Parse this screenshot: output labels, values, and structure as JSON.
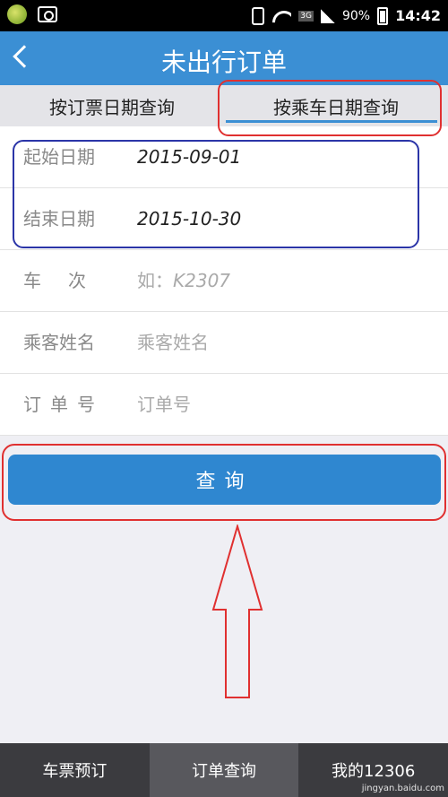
{
  "status_bar": {
    "battery_percent": "90%",
    "time": "14:42",
    "network_type": "3G",
    "icons": [
      "app-icon",
      "camera-icon",
      "phone-icon",
      "wifi-icon",
      "signal-icon",
      "battery-icon"
    ]
  },
  "nav": {
    "title": "未出行订单",
    "back_icon": "chevron-left-icon"
  },
  "tabs": [
    {
      "label": "按订票日期查询",
      "active": false
    },
    {
      "label": "按乘车日期查询",
      "active": true
    }
  ],
  "form": {
    "start_date": {
      "label": "起始日期",
      "value": "2015-09-01"
    },
    "end_date": {
      "label": "结束日期",
      "value": "2015-10-30"
    },
    "train_no": {
      "label_parts": [
        "车",
        "次"
      ],
      "placeholder_prefix": "如：",
      "placeholder_example": "K2307"
    },
    "passenger": {
      "label": "乘客姓名",
      "placeholder": "乘客姓名"
    },
    "order_no": {
      "label_parts": [
        "订",
        "单",
        "号"
      ],
      "placeholder": "订单号"
    }
  },
  "query_button": {
    "label": "查询"
  },
  "bottom_nav": [
    {
      "label": "车票预订",
      "active": false
    },
    {
      "label": "订单查询",
      "active": true
    },
    {
      "label": "我的12306",
      "active": false
    }
  ],
  "watermark": "jingyan.baidu.com",
  "colors": {
    "accent": "#3b8fd4",
    "button": "#2f87d0",
    "annotation_red": "#e03030",
    "annotation_blue": "#2b35a8"
  }
}
